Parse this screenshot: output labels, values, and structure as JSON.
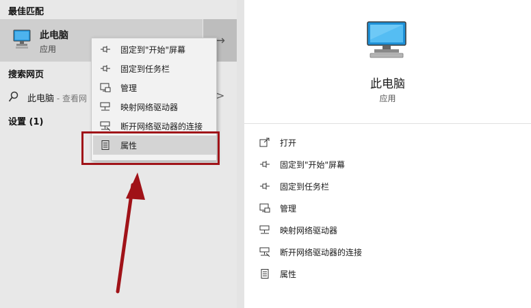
{
  "left": {
    "best_match_heading": "最佳匹配",
    "best_match": {
      "name": "此电脑",
      "type": "应用",
      "arrow": "→"
    },
    "web_heading": "搜索网页",
    "web_result": {
      "term": "此电脑",
      "hint": " - 查看网",
      "chevron": ">"
    },
    "settings_heading": "设置 (1)"
  },
  "context_menu": {
    "items": [
      {
        "label": "固定到\"开始\"屏幕",
        "icon": "pin-icon"
      },
      {
        "label": "固定到任务栏",
        "icon": "pin-icon"
      },
      {
        "label": "管理",
        "icon": "manage-icon"
      },
      {
        "label": "映射网络驱动器",
        "icon": "network-drive-icon"
      },
      {
        "label": "断开网络驱动器的连接",
        "icon": "disconnect-drive-icon"
      },
      {
        "label": "属性",
        "icon": "properties-icon",
        "highlighted": true
      }
    ]
  },
  "right": {
    "title": "此电脑",
    "subtitle": "应用",
    "actions": [
      {
        "label": "打开",
        "icon": "open-icon"
      },
      {
        "label": "固定到\"开始\"屏幕",
        "icon": "pin-icon"
      },
      {
        "label": "固定到任务栏",
        "icon": "pin-icon"
      },
      {
        "label": "管理",
        "icon": "manage-icon"
      },
      {
        "label": "映射网络驱动器",
        "icon": "network-drive-icon"
      },
      {
        "label": "断开网络驱动器的连接",
        "icon": "disconnect-drive-icon"
      },
      {
        "label": "属性",
        "icon": "properties-icon"
      }
    ]
  },
  "colors": {
    "annotation_red": "#a01218",
    "highlight": "#d4d4d4",
    "accent_blue": "#1e90d6"
  }
}
